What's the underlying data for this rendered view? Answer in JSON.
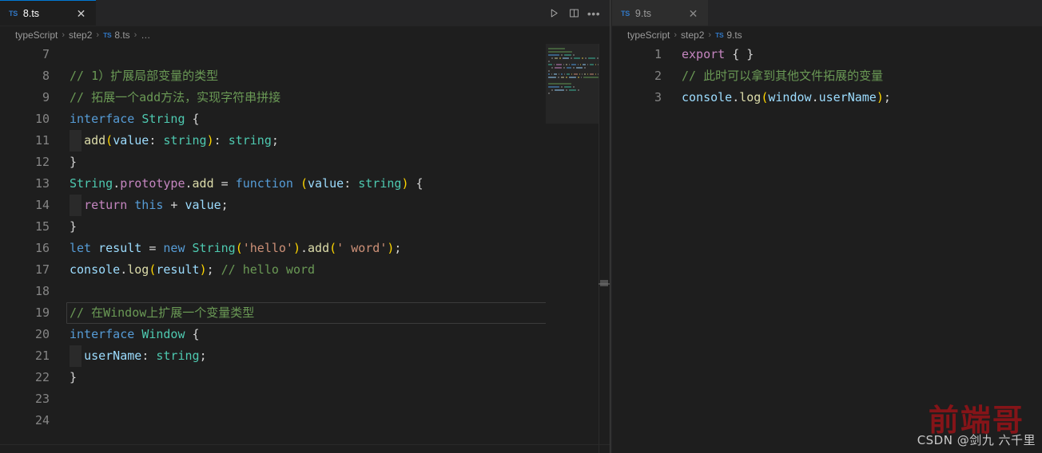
{
  "theme": {
    "editor_bg": "#1e1e1e",
    "tabbar_bg": "#252526",
    "inactive_tab_bg": "#2d2d2d",
    "accent": "#0078d4",
    "ts_icon_color": "#3178c6",
    "comment": "#6a9955",
    "keyword": "#569cd6",
    "keyword_control": "#c586c0",
    "type": "#4ec9b0",
    "function": "#dcdcaa",
    "variable": "#9cdcfe",
    "string": "#ce9178",
    "bracket": "#ffd700",
    "plain": "#d4d4d4",
    "line_number": "#858585"
  },
  "left_pane": {
    "tab": {
      "icon": "typescript-file-icon",
      "icon_label": "TS",
      "label": "8.ts",
      "close_glyph": "✕",
      "active": true
    },
    "actions": [
      {
        "name": "run-file-button",
        "icon": "play-icon"
      },
      {
        "name": "split-editor-button",
        "icon": "split-editor-icon"
      },
      {
        "name": "more-actions-button",
        "icon": "ellipsis-icon",
        "glyph": "•••"
      }
    ],
    "breadcrumb": {
      "items": [
        "typeScript",
        "step2",
        "8.ts",
        "…"
      ],
      "separator": "›",
      "file_icon_label": "TS",
      "file_icon_index": 2
    },
    "first_line_number": 7,
    "active_line": 19,
    "code_lines": [
      {
        "n": 7,
        "tokens": []
      },
      {
        "n": 8,
        "tokens": [
          {
            "t": "// 1）扩展局部变量的类型",
            "c": "c-comment"
          }
        ]
      },
      {
        "n": 9,
        "tokens": [
          {
            "t": "// 拓展一个add方法，实现字符串拼接",
            "c": "c-comment"
          }
        ]
      },
      {
        "n": 10,
        "tokens": [
          {
            "t": "interface",
            "c": "c-keyword"
          },
          {
            "t": " ",
            "c": "c-plain"
          },
          {
            "t": "String",
            "c": "c-type"
          },
          {
            "t": " {",
            "c": "c-plain"
          }
        ]
      },
      {
        "n": 11,
        "indent": true,
        "tokens": [
          {
            "t": "  ",
            "c": "c-plain"
          },
          {
            "t": "add",
            "c": "c-fn"
          },
          {
            "t": "(",
            "c": "c-paren"
          },
          {
            "t": "value",
            "c": "c-var"
          },
          {
            "t": ": ",
            "c": "c-plain"
          },
          {
            "t": "string",
            "c": "c-type"
          },
          {
            "t": ")",
            "c": "c-paren"
          },
          {
            "t": ": ",
            "c": "c-plain"
          },
          {
            "t": "string",
            "c": "c-type"
          },
          {
            "t": ";",
            "c": "c-plain"
          }
        ]
      },
      {
        "n": 12,
        "tokens": [
          {
            "t": "}",
            "c": "c-plain"
          }
        ]
      },
      {
        "n": 13,
        "tokens": [
          {
            "t": "String",
            "c": "c-type"
          },
          {
            "t": ".",
            "c": "c-plain"
          },
          {
            "t": "prototype",
            "c": "c-kw-purple"
          },
          {
            "t": ".",
            "c": "c-plain"
          },
          {
            "t": "add",
            "c": "c-fn"
          },
          {
            "t": " = ",
            "c": "c-plain"
          },
          {
            "t": "function",
            "c": "c-keyword"
          },
          {
            "t": " ",
            "c": "c-plain"
          },
          {
            "t": "(",
            "c": "c-paren"
          },
          {
            "t": "value",
            "c": "c-var"
          },
          {
            "t": ": ",
            "c": "c-plain"
          },
          {
            "t": "string",
            "c": "c-type"
          },
          {
            "t": ")",
            "c": "c-paren"
          },
          {
            "t": " {",
            "c": "c-plain"
          }
        ]
      },
      {
        "n": 14,
        "indent": true,
        "tokens": [
          {
            "t": "  ",
            "c": "c-plain"
          },
          {
            "t": "return",
            "c": "c-kw-purple"
          },
          {
            "t": " ",
            "c": "c-plain"
          },
          {
            "t": "this",
            "c": "c-keyword"
          },
          {
            "t": " + ",
            "c": "c-plain"
          },
          {
            "t": "value",
            "c": "c-var"
          },
          {
            "t": ";",
            "c": "c-plain"
          }
        ]
      },
      {
        "n": 15,
        "tokens": [
          {
            "t": "}",
            "c": "c-plain"
          }
        ]
      },
      {
        "n": 16,
        "tokens": [
          {
            "t": "let",
            "c": "c-keyword"
          },
          {
            "t": " ",
            "c": "c-plain"
          },
          {
            "t": "result",
            "c": "c-var"
          },
          {
            "t": " = ",
            "c": "c-plain"
          },
          {
            "t": "new",
            "c": "c-keyword"
          },
          {
            "t": " ",
            "c": "c-plain"
          },
          {
            "t": "String",
            "c": "c-type"
          },
          {
            "t": "(",
            "c": "c-paren"
          },
          {
            "t": "'hello'",
            "c": "c-string"
          },
          {
            "t": ")",
            "c": "c-paren"
          },
          {
            "t": ".",
            "c": "c-plain"
          },
          {
            "t": "add",
            "c": "c-fn"
          },
          {
            "t": "(",
            "c": "c-paren"
          },
          {
            "t": "' word'",
            "c": "c-string"
          },
          {
            "t": ")",
            "c": "c-paren"
          },
          {
            "t": ";",
            "c": "c-plain"
          }
        ]
      },
      {
        "n": 17,
        "tokens": [
          {
            "t": "console",
            "c": "c-var"
          },
          {
            "t": ".",
            "c": "c-plain"
          },
          {
            "t": "log",
            "c": "c-fn"
          },
          {
            "t": "(",
            "c": "c-paren"
          },
          {
            "t": "result",
            "c": "c-var"
          },
          {
            "t": ")",
            "c": "c-paren"
          },
          {
            "t": "; ",
            "c": "c-plain"
          },
          {
            "t": "// hello word",
            "c": "c-comment"
          }
        ]
      },
      {
        "n": 18,
        "tokens": []
      },
      {
        "n": 19,
        "tokens": [
          {
            "t": "// 在Window上扩展一个变量类型",
            "c": "c-comment"
          }
        ]
      },
      {
        "n": 20,
        "tokens": [
          {
            "t": "interface",
            "c": "c-keyword"
          },
          {
            "t": " ",
            "c": "c-plain"
          },
          {
            "t": "Window",
            "c": "c-type"
          },
          {
            "t": " {",
            "c": "c-plain"
          }
        ]
      },
      {
        "n": 21,
        "indent": true,
        "tokens": [
          {
            "t": "  ",
            "c": "c-plain"
          },
          {
            "t": "userName",
            "c": "c-var"
          },
          {
            "t": ": ",
            "c": "c-plain"
          },
          {
            "t": "string",
            "c": "c-type"
          },
          {
            "t": ";",
            "c": "c-plain"
          }
        ]
      },
      {
        "n": 22,
        "tokens": [
          {
            "t": "}",
            "c": "c-plain"
          }
        ]
      },
      {
        "n": 23,
        "tokens": []
      },
      {
        "n": 24,
        "tokens": []
      }
    ]
  },
  "right_pane": {
    "tab": {
      "icon": "typescript-file-icon",
      "icon_label": "TS",
      "label": "9.ts",
      "close_glyph": "✕",
      "active": false
    },
    "breadcrumb": {
      "items": [
        "typeScript",
        "step2",
        "9.ts"
      ],
      "separator": "›",
      "file_icon_label": "TS",
      "file_icon_index": 2
    },
    "active_line": 3,
    "code_lines": [
      {
        "n": 1,
        "tokens": [
          {
            "t": "export",
            "c": "c-kw-purple"
          },
          {
            "t": " { }",
            "c": "c-plain"
          }
        ]
      },
      {
        "n": 2,
        "tokens": [
          {
            "t": "// 此时可以拿到其他文件拓展的变量",
            "c": "c-comment"
          }
        ]
      },
      {
        "n": 3,
        "tokens": [
          {
            "t": "console",
            "c": "c-var"
          },
          {
            "t": ".",
            "c": "c-plain"
          },
          {
            "t": "log",
            "c": "c-fn"
          },
          {
            "t": "(",
            "c": "c-paren"
          },
          {
            "t": "window",
            "c": "c-var"
          },
          {
            "t": ".",
            "c": "c-plain"
          },
          {
            "t": "userName",
            "c": "c-var"
          },
          {
            "t": ")",
            "c": "c-paren"
          },
          {
            "t": ";",
            "c": "c-plain"
          }
        ]
      }
    ]
  },
  "watermark": {
    "title": "前端哥",
    "subtitle": "CSDN @剑九 六千里"
  }
}
